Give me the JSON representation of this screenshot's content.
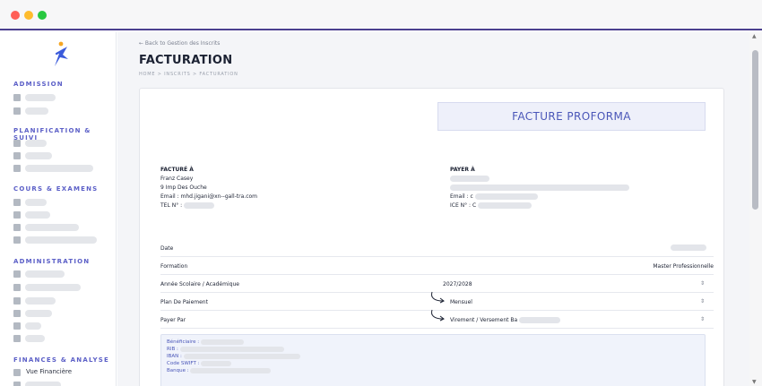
{
  "window": {
    "controls": [
      "close",
      "minimize",
      "maximize"
    ]
  },
  "sidebar": {
    "sections": [
      {
        "title": "ADMISSION"
      },
      {
        "title": "PLANIFICATION & SUIVI"
      },
      {
        "title": "COURS & EXAMENS"
      },
      {
        "title": "ADMINISTRATION"
      },
      {
        "title": "FINANCES & ANALYSE"
      }
    ],
    "visible_item": {
      "label": "Vue Financière",
      "icon": "chart-icon"
    }
  },
  "header": {
    "back_link": "← Back to Gestion des Inscrits",
    "title": "FACTURATION",
    "breadcrumb": "HOME > INSCRITS > FACTURATION"
  },
  "invoice": {
    "proforma_title": "FACTURE PROFORMA",
    "billed_to": {
      "heading": "FACTURÉ À",
      "name": "Franz Casey",
      "address": "9 Imp Des Ouche",
      "email": "Email : mhd.jigani@xn--gall-tra.com",
      "tel": "TEL N° :"
    },
    "payer": {
      "heading": "PAYER À",
      "email": "Email : c",
      "ice": "ICE N° : C"
    },
    "rows": {
      "date_label": "Date",
      "formation_label": "Formation",
      "formation_value": "Master Professionnelle",
      "annee_label": "Année Scolaire / Académique",
      "annee_value": "2027/2028",
      "plan_label": "Plan De Paiement",
      "plan_value": "Mensuel",
      "payer_label": "Payer Par",
      "payer_value": "Virement / Versement Ba"
    },
    "bank": {
      "beneficiaire": "Bénéficiaire :",
      "rib": "RIB :",
      "iban": "IBAN :",
      "swift": "Code SWIFT :",
      "banque": "Banque :"
    }
  },
  "colors": {
    "accent": "#4a56b8",
    "window_border": "#4b3f8f",
    "section_title": "#5b5fc7"
  }
}
